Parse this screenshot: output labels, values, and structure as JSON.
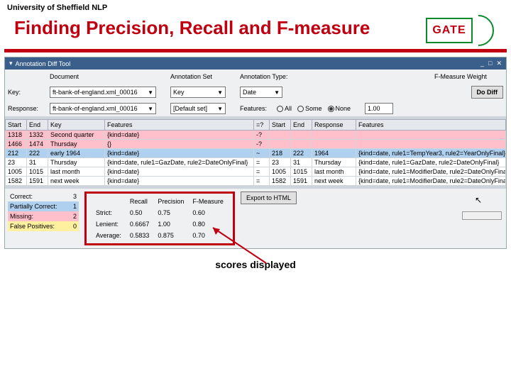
{
  "header": {
    "affiliation": "University of Sheffield NLP",
    "title": "Finding Precision, Recall and F-measure",
    "logo_text": "GATE"
  },
  "tool": {
    "title": "Annotation Diff Tool",
    "labels": {
      "key": "Key:",
      "response": "Response:"
    },
    "cols": {
      "document": "Document",
      "annotation_set": "Annotation Set",
      "annotation_type": "Annotation Type:",
      "fmeasure_weight": "F-Measure Weight"
    },
    "key_doc": "ft-bank-of-england.xml_00016",
    "resp_doc": "ft-bank-of-england.xml_00016",
    "key_set": "Key",
    "resp_set": "[Default set]",
    "type_value": "Date",
    "features_label": "Features:",
    "features_opts": {
      "all": "All",
      "some": "Some",
      "none": "None"
    },
    "weight": "1.00",
    "do_diff": "Do Diff"
  },
  "grid": {
    "headers": {
      "start": "Start",
      "end": "End",
      "key": "Key",
      "features": "Features",
      "eq": "=?",
      "start2": "Start",
      "end2": "End",
      "response": "Response",
      "features2": "Features"
    },
    "rows": [
      {
        "cls": "r-pink",
        "s": "1318",
        "e": "1332",
        "k": "Second quarter",
        "f": "{kind=date}",
        "eq": "-?",
        "s2": "",
        "e2": "",
        "r": "",
        "f2": ""
      },
      {
        "cls": "r-pink",
        "s": "1466",
        "e": "1474",
        "k": "Thursday",
        "f": "{}",
        "eq": "-?",
        "s2": "",
        "e2": "",
        "r": "",
        "f2": ""
      },
      {
        "cls": "r-blue",
        "s": "212",
        "e": "222",
        "k": "early 1964",
        "f": "{kind=date}",
        "eq": "~",
        "s2": "218",
        "e2": "222",
        "r": "1964",
        "f2": "{kind=date, rule1=TempYear3, rule2=YearOnlyFinal}"
      },
      {
        "cls": "",
        "s": "23",
        "e": "31",
        "k": "Thursday",
        "f": "{kind=date, rule1=GazDate, rule2=DateOnlyFinal}",
        "eq": "=",
        "s2": "23",
        "e2": "31",
        "r": "Thursday",
        "f2": "{kind=date, rule1=GazDate, rule2=DateOnlyFinal}"
      },
      {
        "cls": "",
        "s": "1005",
        "e": "1015",
        "k": "last month",
        "f": "{kind=date}",
        "eq": "=",
        "s2": "1005",
        "e2": "1015",
        "r": "last month",
        "f2": "{kind=date, rule1=ModifierDate, rule2=DateOnlyFinal}"
      },
      {
        "cls": "",
        "s": "1582",
        "e": "1591",
        "k": "next week",
        "f": "{kind=date}",
        "eq": "=",
        "s2": "1582",
        "e2": "1591",
        "r": "next week",
        "f2": "{kind=date, rule1=ModifierDate, rule2=DateOnlyFinal}"
      }
    ]
  },
  "counts": {
    "correct_lbl": "Correct:",
    "correct_val": "3",
    "partial_lbl": "Partially Correct:",
    "partial_val": "1",
    "missing_lbl": "Missing:",
    "missing_val": "2",
    "fp_lbl": "False Positives:",
    "fp_val": "0"
  },
  "scores": {
    "hdr": {
      "recall": "Recall",
      "precision": "Precision",
      "fmeasure": "F-Measure"
    },
    "rows": [
      {
        "lab": "Strict:",
        "r": "0.50",
        "p": "0.75",
        "f": "0.60"
      },
      {
        "lab": "Lenient:",
        "r": "0.6667",
        "p": "1.00",
        "f": "0.80"
      },
      {
        "lab": "Average:",
        "r": "0.5833",
        "p": "0.875",
        "f": "0.70"
      }
    ]
  },
  "export_label": "Export to HTML",
  "caption": "scores displayed"
}
